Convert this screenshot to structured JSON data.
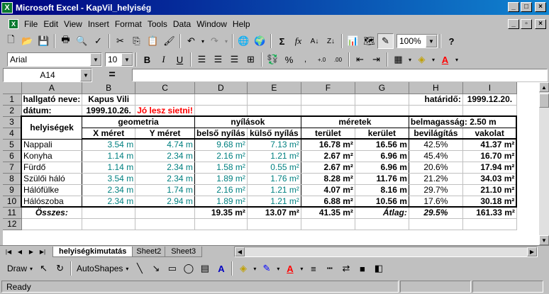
{
  "window": {
    "title": "Microsoft Excel - KapVil_helyiség",
    "app_icon": "X"
  },
  "menu": [
    "File",
    "Edit",
    "View",
    "Insert",
    "Format",
    "Tools",
    "Data",
    "Window",
    "Help"
  ],
  "toolbar": {
    "zoom": "100%",
    "font": "Arial",
    "size": "10"
  },
  "formula_bar": {
    "name_box": "A14",
    "equals": "=",
    "content": ""
  },
  "columns": [
    "A",
    "B",
    "C",
    "D",
    "E",
    "F",
    "G",
    "H",
    "I"
  ],
  "rows": [
    "1",
    "2",
    "3",
    "4",
    "5",
    "6",
    "7",
    "8",
    "9",
    "10",
    "11",
    "12"
  ],
  "sheet": {
    "r1": {
      "label": "hallgató neve:",
      "name": "Kapus Vili",
      "deadline_label": "határidő:",
      "deadline": "1999.12.20."
    },
    "r2": {
      "label": "dátum:",
      "date": "1999.10.26.",
      "note": "Jó lesz sietni!"
    },
    "r3": {
      "helyisegek": "helyiségek",
      "geometria": "geometria",
      "nyilasok": "nyílások",
      "meretek": "méretek",
      "belmagassag": "belmagasság: 2.50 m"
    },
    "r4": {
      "x": "X méret",
      "y": "Y méret",
      "belso": "belső nyílás",
      "kulso": "külső nyílás",
      "terulet": "terület",
      "kerulet": "kerület",
      "bevilagitas": "bevilágítás",
      "vakolat": "vakolat"
    },
    "data_rows": [
      {
        "room": "Nappali",
        "x": "3.54 m",
        "y": "4.74 m",
        "bn": "9.68 m²",
        "kn": "7.13 m²",
        "ter": "16.78 m²",
        "ker": "16.56 m",
        "bev": "42.5%",
        "vak": "41.37 m²"
      },
      {
        "room": "Konyha",
        "x": "1.14 m",
        "y": "2.34 m",
        "bn": "2.16 m²",
        "kn": "1.21 m²",
        "ter": "2.67 m²",
        "ker": "6.96 m",
        "bev": "45.4%",
        "vak": "16.70 m²"
      },
      {
        "room": "Fürdő",
        "x": "1.14 m",
        "y": "2.34 m",
        "bn": "1.58 m²",
        "kn": "0.55 m²",
        "ter": "2.67 m²",
        "ker": "6.96 m",
        "bev": "20.6%",
        "vak": "17.94 m²"
      },
      {
        "room": "Szülői háló",
        "x": "3.54 m",
        "y": "2.34 m",
        "bn": "1.89 m²",
        "kn": "1.76 m²",
        "ter": "8.28 m²",
        "ker": "11.76 m",
        "bev": "21.2%",
        "vak": "34.03 m²"
      },
      {
        "room": "Hálófülke",
        "x": "2.34 m",
        "y": "1.74 m",
        "bn": "2.16 m²",
        "kn": "1.21 m²",
        "ter": "4.07 m²",
        "ker": "8.16 m",
        "bev": "29.7%",
        "vak": "21.10 m²"
      },
      {
        "room": "Hálószoba",
        "x": "2.34 m",
        "y": "2.94 m",
        "bn": "1.89 m²",
        "kn": "1.21 m²",
        "ter": "6.88 m²",
        "ker": "10.56 m",
        "bev": "17.6%",
        "vak": "30.18 m²"
      }
    ],
    "r11": {
      "label": "Összes:",
      "bn": "19.35 m²",
      "kn": "13.07 m²",
      "ter": "41.35 m²",
      "atlag": "Átlag:",
      "bev": "29.5%",
      "vak": "161.33 m²"
    }
  },
  "sheet_tabs": [
    "helyiségkimutatás",
    "Sheet2",
    "Sheet3"
  ],
  "drawing": {
    "draw": "Draw",
    "autoshapes": "AutoShapes"
  },
  "status": {
    "text": "Ready"
  }
}
